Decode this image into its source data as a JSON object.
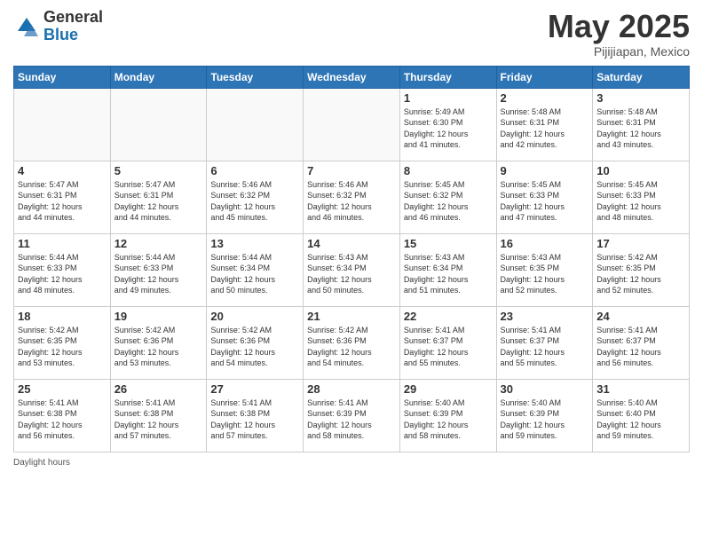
{
  "header": {
    "logo_general": "General",
    "logo_blue": "Blue",
    "month_title": "May 2025",
    "location": "Pijijiapan, Mexico"
  },
  "footer": {
    "label": "Daylight hours"
  },
  "weekdays": [
    "Sunday",
    "Monday",
    "Tuesday",
    "Wednesday",
    "Thursday",
    "Friday",
    "Saturday"
  ],
  "weeks": [
    [
      {
        "day": "",
        "info": ""
      },
      {
        "day": "",
        "info": ""
      },
      {
        "day": "",
        "info": ""
      },
      {
        "day": "",
        "info": ""
      },
      {
        "day": "1",
        "info": "Sunrise: 5:49 AM\nSunset: 6:30 PM\nDaylight: 12 hours\nand 41 minutes."
      },
      {
        "day": "2",
        "info": "Sunrise: 5:48 AM\nSunset: 6:31 PM\nDaylight: 12 hours\nand 42 minutes."
      },
      {
        "day": "3",
        "info": "Sunrise: 5:48 AM\nSunset: 6:31 PM\nDaylight: 12 hours\nand 43 minutes."
      }
    ],
    [
      {
        "day": "4",
        "info": "Sunrise: 5:47 AM\nSunset: 6:31 PM\nDaylight: 12 hours\nand 44 minutes."
      },
      {
        "day": "5",
        "info": "Sunrise: 5:47 AM\nSunset: 6:31 PM\nDaylight: 12 hours\nand 44 minutes."
      },
      {
        "day": "6",
        "info": "Sunrise: 5:46 AM\nSunset: 6:32 PM\nDaylight: 12 hours\nand 45 minutes."
      },
      {
        "day": "7",
        "info": "Sunrise: 5:46 AM\nSunset: 6:32 PM\nDaylight: 12 hours\nand 46 minutes."
      },
      {
        "day": "8",
        "info": "Sunrise: 5:45 AM\nSunset: 6:32 PM\nDaylight: 12 hours\nand 46 minutes."
      },
      {
        "day": "9",
        "info": "Sunrise: 5:45 AM\nSunset: 6:33 PM\nDaylight: 12 hours\nand 47 minutes."
      },
      {
        "day": "10",
        "info": "Sunrise: 5:45 AM\nSunset: 6:33 PM\nDaylight: 12 hours\nand 48 minutes."
      }
    ],
    [
      {
        "day": "11",
        "info": "Sunrise: 5:44 AM\nSunset: 6:33 PM\nDaylight: 12 hours\nand 48 minutes."
      },
      {
        "day": "12",
        "info": "Sunrise: 5:44 AM\nSunset: 6:33 PM\nDaylight: 12 hours\nand 49 minutes."
      },
      {
        "day": "13",
        "info": "Sunrise: 5:44 AM\nSunset: 6:34 PM\nDaylight: 12 hours\nand 50 minutes."
      },
      {
        "day": "14",
        "info": "Sunrise: 5:43 AM\nSunset: 6:34 PM\nDaylight: 12 hours\nand 50 minutes."
      },
      {
        "day": "15",
        "info": "Sunrise: 5:43 AM\nSunset: 6:34 PM\nDaylight: 12 hours\nand 51 minutes."
      },
      {
        "day": "16",
        "info": "Sunrise: 5:43 AM\nSunset: 6:35 PM\nDaylight: 12 hours\nand 52 minutes."
      },
      {
        "day": "17",
        "info": "Sunrise: 5:42 AM\nSunset: 6:35 PM\nDaylight: 12 hours\nand 52 minutes."
      }
    ],
    [
      {
        "day": "18",
        "info": "Sunrise: 5:42 AM\nSunset: 6:35 PM\nDaylight: 12 hours\nand 53 minutes."
      },
      {
        "day": "19",
        "info": "Sunrise: 5:42 AM\nSunset: 6:36 PM\nDaylight: 12 hours\nand 53 minutes."
      },
      {
        "day": "20",
        "info": "Sunrise: 5:42 AM\nSunset: 6:36 PM\nDaylight: 12 hours\nand 54 minutes."
      },
      {
        "day": "21",
        "info": "Sunrise: 5:42 AM\nSunset: 6:36 PM\nDaylight: 12 hours\nand 54 minutes."
      },
      {
        "day": "22",
        "info": "Sunrise: 5:41 AM\nSunset: 6:37 PM\nDaylight: 12 hours\nand 55 minutes."
      },
      {
        "day": "23",
        "info": "Sunrise: 5:41 AM\nSunset: 6:37 PM\nDaylight: 12 hours\nand 55 minutes."
      },
      {
        "day": "24",
        "info": "Sunrise: 5:41 AM\nSunset: 6:37 PM\nDaylight: 12 hours\nand 56 minutes."
      }
    ],
    [
      {
        "day": "25",
        "info": "Sunrise: 5:41 AM\nSunset: 6:38 PM\nDaylight: 12 hours\nand 56 minutes."
      },
      {
        "day": "26",
        "info": "Sunrise: 5:41 AM\nSunset: 6:38 PM\nDaylight: 12 hours\nand 57 minutes."
      },
      {
        "day": "27",
        "info": "Sunrise: 5:41 AM\nSunset: 6:38 PM\nDaylight: 12 hours\nand 57 minutes."
      },
      {
        "day": "28",
        "info": "Sunrise: 5:41 AM\nSunset: 6:39 PM\nDaylight: 12 hours\nand 58 minutes."
      },
      {
        "day": "29",
        "info": "Sunrise: 5:40 AM\nSunset: 6:39 PM\nDaylight: 12 hours\nand 58 minutes."
      },
      {
        "day": "30",
        "info": "Sunrise: 5:40 AM\nSunset: 6:39 PM\nDaylight: 12 hours\nand 59 minutes."
      },
      {
        "day": "31",
        "info": "Sunrise: 5:40 AM\nSunset: 6:40 PM\nDaylight: 12 hours\nand 59 minutes."
      }
    ]
  ]
}
